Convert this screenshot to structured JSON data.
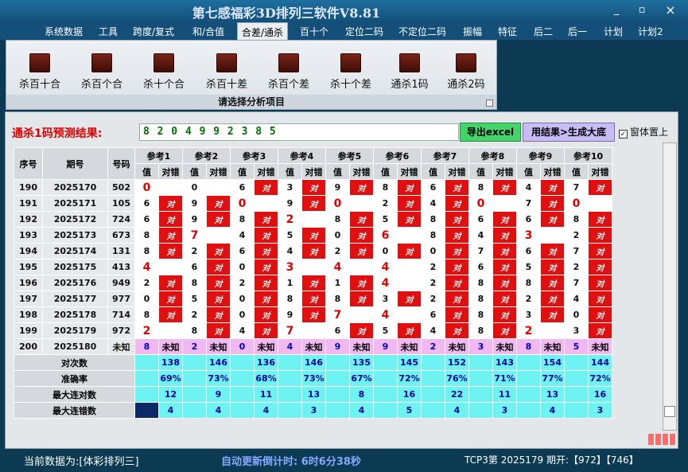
{
  "app": {
    "title": "第七感福彩3D排列三软件V8.81",
    "min": "_",
    "max": "▫",
    "close": "×"
  },
  "menu": [
    "系统数据",
    "工具",
    "跨度/复式",
    "和/合值",
    "合差/通杀",
    "百十个",
    "定位二码",
    "不定位二码",
    "振幅",
    "特征",
    "后二",
    "后一",
    "计划",
    "计划2"
  ],
  "ribbon": {
    "buttons": [
      "杀百十合",
      "杀百个合",
      "杀十个合",
      "杀百十差",
      "杀百个差",
      "杀十个差",
      "通杀1码",
      "通杀2码"
    ],
    "footer": "请选择分析项目"
  },
  "predict": {
    "label": "通杀1码预测结果:",
    "value": "8 2 0 4 9 9 2 3 8 5",
    "excel": "导出excel",
    "apply": "用结果>生成大底",
    "ontop": "窗体置上"
  },
  "table": {
    "head": [
      "序号",
      "期号",
      "号码"
    ],
    "refs": [
      "参考1",
      "参考2",
      "参考3",
      "参考4",
      "参考5",
      "参考6",
      "参考7",
      "参考8",
      "参考9",
      "参考10"
    ],
    "sub": [
      "值",
      "对错"
    ],
    "rows": [
      {
        "n": "190",
        "p": "2025170",
        "h": "502",
        "c": [
          [
            "0",
            "R"
          ],
          [
            "0",
            "0"
          ],
          [
            "6",
            "1"
          ],
          [
            "3",
            "1"
          ],
          [
            "9",
            "1"
          ],
          [
            "8",
            "1"
          ],
          [
            "6",
            "1"
          ],
          [
            "8",
            "1"
          ],
          [
            "4",
            "1"
          ],
          [
            "7",
            "1"
          ]
        ]
      },
      {
        "n": "191",
        "p": "2025171",
        "h": "105",
        "c": [
          [
            "6",
            "1"
          ],
          [
            "9",
            "1"
          ],
          [
            "0",
            "R"
          ],
          [
            "9",
            "1"
          ],
          [
            "0",
            "R"
          ],
          [
            "2",
            "1"
          ],
          [
            "4",
            "1"
          ],
          [
            "0",
            "R"
          ],
          [
            "7",
            "1"
          ],
          [
            "0",
            "R"
          ]
        ]
      },
      {
        "n": "192",
        "p": "2025172",
        "h": "724",
        "c": [
          [
            "6",
            "1"
          ],
          [
            "9",
            "1"
          ],
          [
            "8",
            "1"
          ],
          [
            "2",
            "R"
          ],
          [
            "8",
            "1"
          ],
          [
            "5",
            "1"
          ],
          [
            "8",
            "1"
          ],
          [
            "6",
            "1"
          ],
          [
            "6",
            "1"
          ],
          [
            "8",
            "1"
          ]
        ]
      },
      {
        "n": "193",
        "p": "2025173",
        "h": "673",
        "c": [
          [
            "8",
            "1"
          ],
          [
            "7",
            "R"
          ],
          [
            "4",
            "1"
          ],
          [
            "5",
            "1"
          ],
          [
            "0",
            "1"
          ],
          [
            "6",
            "R"
          ],
          [
            "8",
            "1"
          ],
          [
            "4",
            "1"
          ],
          [
            "3",
            "R"
          ],
          [
            "2",
            "1"
          ]
        ]
      },
      {
        "n": "194",
        "p": "2025174",
        "h": "131",
        "c": [
          [
            "8",
            "1"
          ],
          [
            "2",
            "1"
          ],
          [
            "6",
            "1"
          ],
          [
            "4",
            "1"
          ],
          [
            "2",
            "1"
          ],
          [
            "0",
            "1"
          ],
          [
            "0",
            "1"
          ],
          [
            "7",
            "1"
          ],
          [
            "6",
            "1"
          ],
          [
            "7",
            "1"
          ]
        ]
      },
      {
        "n": "195",
        "p": "2025175",
        "h": "413",
        "c": [
          [
            "4",
            "R"
          ],
          [
            "6",
            "1"
          ],
          [
            "0",
            "1"
          ],
          [
            "3",
            "R"
          ],
          [
            "4",
            "R"
          ],
          [
            "4",
            "R"
          ],
          [
            "2",
            "1"
          ],
          [
            "6",
            "1"
          ],
          [
            "5",
            "1"
          ],
          [
            "2",
            "1"
          ]
        ]
      },
      {
        "n": "196",
        "p": "2025176",
        "h": "949",
        "c": [
          [
            "2",
            "1"
          ],
          [
            "8",
            "1"
          ],
          [
            "2",
            "1"
          ],
          [
            "1",
            "1"
          ],
          [
            "1",
            "1"
          ],
          [
            "4",
            "R"
          ],
          [
            "2",
            "1"
          ],
          [
            "8",
            "1"
          ],
          [
            "8",
            "1"
          ],
          [
            "7",
            "1"
          ]
        ]
      },
      {
        "n": "197",
        "p": "2025177",
        "h": "977",
        "c": [
          [
            "0",
            "1"
          ],
          [
            "5",
            "1"
          ],
          [
            "0",
            "1"
          ],
          [
            "8",
            "1"
          ],
          [
            "8",
            "1"
          ],
          [
            "3",
            "1"
          ],
          [
            "2",
            "1"
          ],
          [
            "8",
            "1"
          ],
          [
            "2",
            "1"
          ],
          [
            "4",
            "1"
          ]
        ]
      },
      {
        "n": "198",
        "p": "2025178",
        "h": "714",
        "c": [
          [
            "8",
            "1"
          ],
          [
            "2",
            "1"
          ],
          [
            "0",
            "1"
          ],
          [
            "9",
            "1"
          ],
          [
            "7",
            "R"
          ],
          [
            "4",
            "R"
          ],
          [
            "6",
            "1"
          ],
          [
            "8",
            "1"
          ],
          [
            "3",
            "1"
          ],
          [
            "0",
            "1"
          ]
        ]
      },
      {
        "n": "199",
        "p": "2025179",
        "h": "972",
        "c": [
          [
            "2",
            "R"
          ],
          [
            "8",
            "1"
          ],
          [
            "4",
            "1"
          ],
          [
            "7",
            "R"
          ],
          [
            "6",
            "1"
          ],
          [
            "5",
            "1"
          ],
          [
            "4",
            "1"
          ],
          [
            "8",
            "1"
          ],
          [
            "2",
            "R"
          ],
          [
            "3",
            "1"
          ]
        ]
      }
    ],
    "next": {
      "n": "200",
      "p": "2025180",
      "h": "未知",
      "vals": [
        "8",
        "2",
        "0",
        "4",
        "9",
        "9",
        "2",
        "3",
        "8",
        "5"
      ],
      "mark": "未知"
    },
    "stats": [
      {
        "label": "对次数",
        "vals": [
          "138",
          "146",
          "136",
          "146",
          "135",
          "145",
          "152",
          "143",
          "154",
          "144"
        ]
      },
      {
        "label": "准确率",
        "vals": [
          "69%",
          "73%",
          "68%",
          "73%",
          "67%",
          "72%",
          "76%",
          "71%",
          "77%",
          "72%"
        ]
      },
      {
        "label": "最大连对数",
        "vals": [
          "12",
          "9",
          "11",
          "13",
          "8",
          "16",
          "22",
          "11",
          "13",
          "16"
        ]
      },
      {
        "label": "最大连错数",
        "vals": [
          "4",
          "4",
          "4",
          "3",
          "4",
          "5",
          "4",
          "3",
          "4",
          "3"
        ]
      }
    ],
    "ok": "对"
  },
  "status": {
    "source": "当前数据为:[体彩排列三]",
    "countdown": "自动更新倒计时: 6时6分38秒",
    "issue": "TCP3第 2025179 期开:【972】【746】"
  }
}
